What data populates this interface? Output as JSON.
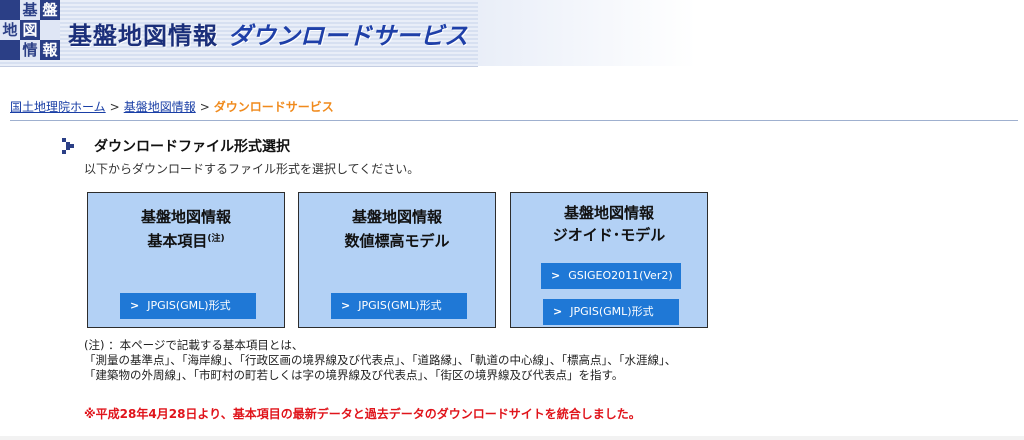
{
  "header": {
    "logo_chars": [
      "基",
      "盤",
      "地",
      "図",
      "情",
      "報"
    ],
    "title": "基盤地図情報",
    "subtitle": "ダウンロードサービス"
  },
  "breadcrumb": {
    "items": [
      "国土地理院ホーム",
      "基盤地図情報"
    ],
    "separator": ">",
    "current": "ダウンロードサービス"
  },
  "section": {
    "title": "ダウンロードファイル形式選択",
    "lead": "以下からダウンロードするファイル形式を選択してください。"
  },
  "cards": [
    {
      "title_line1": "基盤地図情報",
      "title_line2": "基本項目",
      "note_mark": "(注)",
      "buttons": [
        {
          "arrow": ">",
          "label": "JPGIS(GML)形式"
        }
      ]
    },
    {
      "title_line1": "基盤地図情報",
      "title_line2": "数値標高モデル",
      "buttons": [
        {
          "arrow": ">",
          "label": "JPGIS(GML)形式"
        }
      ]
    },
    {
      "title_line1": "基盤地図情報",
      "title_line2": "ジオイド･モデル",
      "buttons": [
        {
          "arrow": ">",
          "label": "GSIGEO2011(Ver2)"
        },
        {
          "arrow": ">",
          "label": "JPGIS(GML)形式"
        }
      ]
    }
  ],
  "notes": {
    "line1": "(注) ：本ページで記載する基本項目とは、",
    "line2": "「測量の基準点」、「海岸線」、「行政区画の境界線及び代表点」、「道路縁」、「軌道の中心線」、「標高点」、「水涯線」、",
    "line3": "「建築物の外周線」、「市町村の町若しくは字の境界線及び代表点」、「街区の境界線及び代表点」を指す。"
  },
  "notice": "※平成28年4月28日より、基本項目の最新データと過去データのダウンロードサイトを統合しました。",
  "colors": {
    "card_bg": "#b3d1f5",
    "button_bg": "#1f78d6",
    "breadcrumb_current": "#f08a1c",
    "notice": "#e0141b",
    "header_title": "#1b2f7a"
  }
}
